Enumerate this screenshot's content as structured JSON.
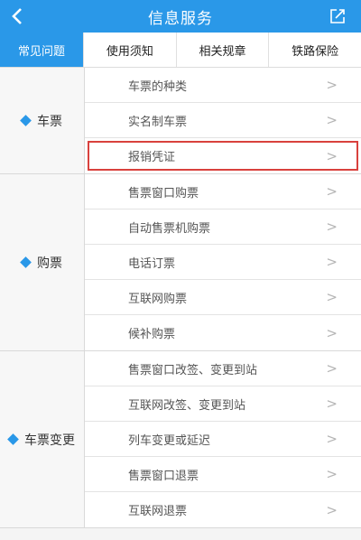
{
  "header": {
    "title": "信息服务"
  },
  "tabs": [
    {
      "label": "常见问题",
      "active": true
    },
    {
      "label": "使用须知",
      "active": false
    },
    {
      "label": "相关规章",
      "active": false
    },
    {
      "label": "铁路保险",
      "active": false
    }
  ],
  "sections": [
    {
      "label": "车票",
      "items": [
        "车票的种类",
        "实名制车票",
        "报销凭证"
      ]
    },
    {
      "label": "购票",
      "items": [
        "售票窗口购票",
        "自动售票机购票",
        "电话订票",
        "互联网购票",
        "候补购票"
      ]
    },
    {
      "label": "车票变更",
      "items": [
        "售票窗口改签、变更到站",
        "互联网改签、变更到站",
        "列车变更或延迟",
        "售票窗口退票",
        "互联网退票"
      ]
    }
  ],
  "colors": {
    "accent": "#2a98e8",
    "highlight": "#d9413d"
  },
  "icons": {
    "back": "chevron-left-icon",
    "share": "share-icon",
    "row": "chevron-right-icon",
    "bullet": "diamond-icon"
  }
}
